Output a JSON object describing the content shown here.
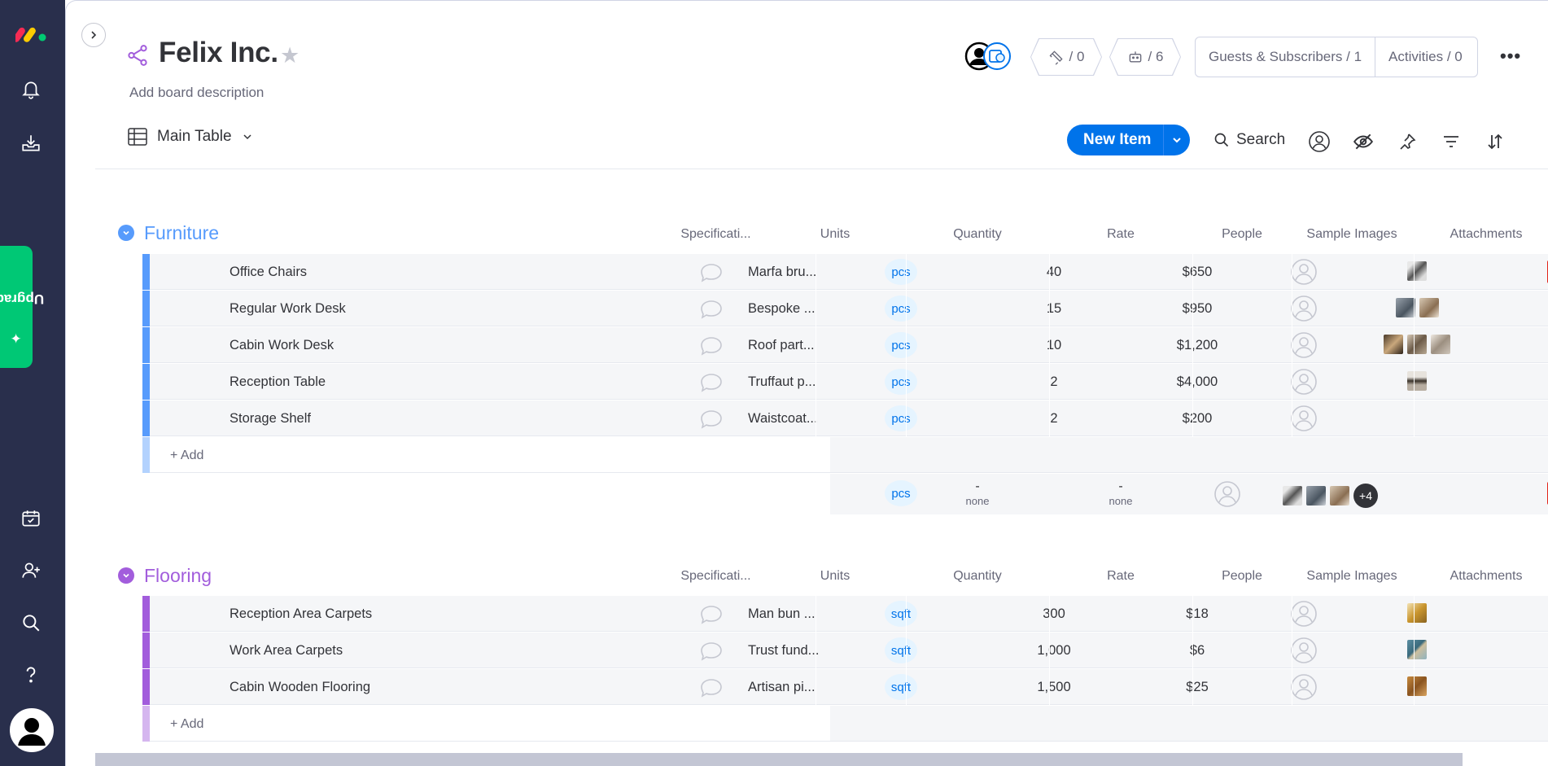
{
  "board": {
    "title": "Felix Inc.",
    "description": "Add board description"
  },
  "header": {
    "integrations_count": "/ 0",
    "automations_count": "/ 6",
    "guests_label": "Guests & Subscribers / 1",
    "activities_label": "Activities / 0"
  },
  "toolbar": {
    "view_label": "Main Table",
    "new_item_label": "New Item",
    "search_label": "Search"
  },
  "sidebar": {
    "upgrade_label": "Upgrade"
  },
  "columns": {
    "specification": "Specificati...",
    "units": "Units",
    "quantity": "Quantity",
    "rate": "Rate",
    "people": "People",
    "sample_images": "Sample Images",
    "attachments": "Attachments"
  },
  "groups": [
    {
      "name": "Furniture",
      "color": "#579bfc",
      "add_label": "+ Add",
      "rows": [
        {
          "name": "Office Chairs",
          "spec": "Marfa bru...",
          "unit": "pcs",
          "qty": "40",
          "rate": "$650"
        },
        {
          "name": "Regular Work Desk",
          "spec": "Bespoke ...",
          "unit": "pcs",
          "qty": "15",
          "rate": "$950"
        },
        {
          "name": "Cabin Work Desk",
          "spec": "Roof part...",
          "unit": "pcs",
          "qty": "10",
          "rate": "$1,200"
        },
        {
          "name": "Reception Table",
          "spec": "Truffaut p...",
          "unit": "pcs",
          "qty": "2",
          "rate": "$4,000"
        },
        {
          "name": "Storage Shelf",
          "spec": "Waistcoat...",
          "unit": "pcs",
          "qty": "2",
          "rate": "$200"
        }
      ],
      "summary": {
        "unit": "pcs",
        "qty_value": "-",
        "qty_func": "none",
        "rate_value": "-",
        "rate_func": "none",
        "images_more": "+4"
      }
    },
    {
      "name": "Flooring",
      "color": "#a25ddc",
      "add_label": "+ Add",
      "rows": [
        {
          "name": "Reception Area Carpets",
          "spec": "Man bun ...",
          "unit": "sqft",
          "qty": "300",
          "rate": "$18"
        },
        {
          "name": "Work Area Carpets",
          "spec": "Trust fund...",
          "unit": "sqft",
          "qty": "1,000",
          "rate": "$6"
        },
        {
          "name": "Cabin Wooden Flooring",
          "spec": "Artisan pi...",
          "unit": "sqft",
          "qty": "1,500",
          "rate": "$25"
        }
      ]
    }
  ],
  "colors": {
    "rail": "#292f4c",
    "primary": "#0073ea",
    "upgrade": "#00c875"
  }
}
